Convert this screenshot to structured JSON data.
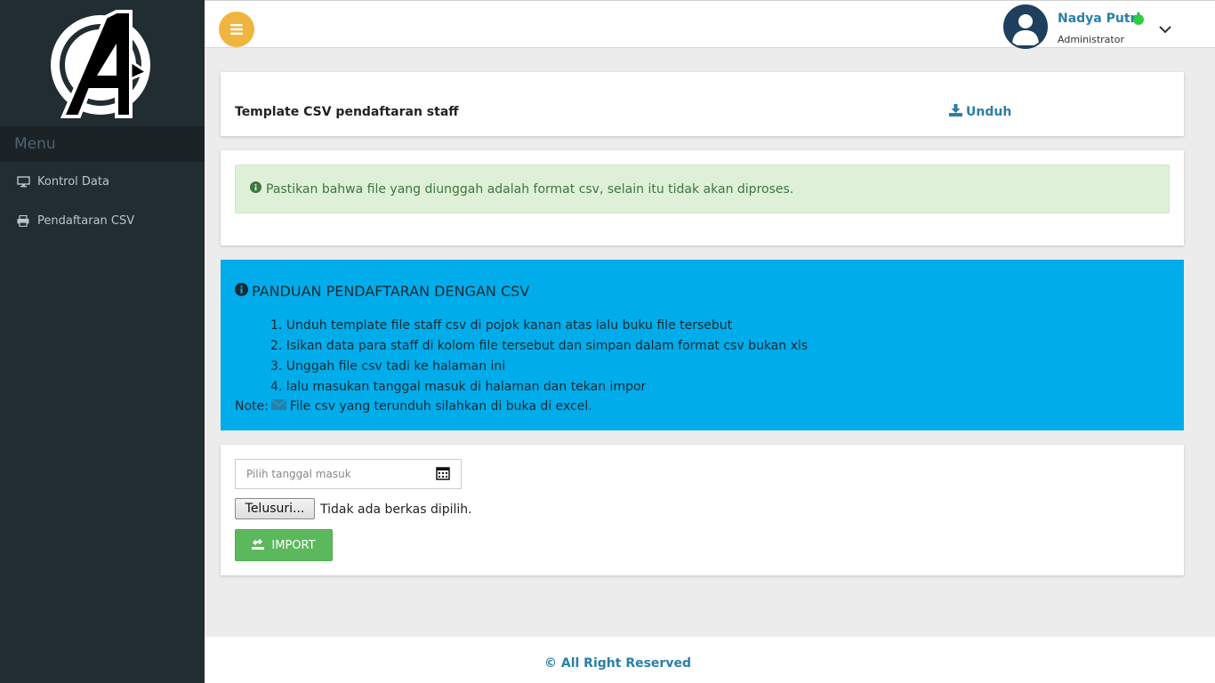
{
  "sidebar": {
    "logo_icon": "avengers-logo-icon",
    "menu_header": "Menu",
    "items": [
      {
        "label": "Kontrol Data",
        "icon": "monitor-icon"
      },
      {
        "label": "Pendaftaran CSV",
        "icon": "printer-icon"
      }
    ]
  },
  "topbar": {
    "menu_icon": "hamburger-icon",
    "user": {
      "name": "Nadya Putri",
      "role": "Administrator",
      "status_color": "#2ecc40"
    }
  },
  "template_panel": {
    "title": "Template CSV pendaftaran staff",
    "download_label": "Unduh"
  },
  "alert": {
    "text": "Pastikan bahwa file yang diunggah adalah format csv, selain itu tidak akan diproses."
  },
  "guide": {
    "title": "PANDUAN PENDAFTARAN DENGAN CSV",
    "steps": [
      "1. Unduh template file staff csv di pojok kanan atas lalu buku file tersebut",
      "2. Isikan data para staff di kolom file tersebut dan simpan dalam format csv bukan xls",
      "3. Unggah file csv tadi ke halaman ini",
      "4. lalu masukan tanggal masuk di halaman dan tekan impor"
    ],
    "note_label": "Note:",
    "note_text": "File csv yang terunduh silahkan di buka di excel."
  },
  "form": {
    "date_placeholder": "Pilih tanggal masuk",
    "browse_label": "Telusuri...",
    "file_status": "Tidak ada berkas dipilih.",
    "import_label": "IMPORT"
  },
  "footer": {
    "text": "© All Right Reserved"
  },
  "colors": {
    "sidebar": "#222d32",
    "accent": "#f0b53f",
    "info_panel": "#00acea",
    "success": "#5cb85c",
    "link": "#2a7fa8"
  }
}
